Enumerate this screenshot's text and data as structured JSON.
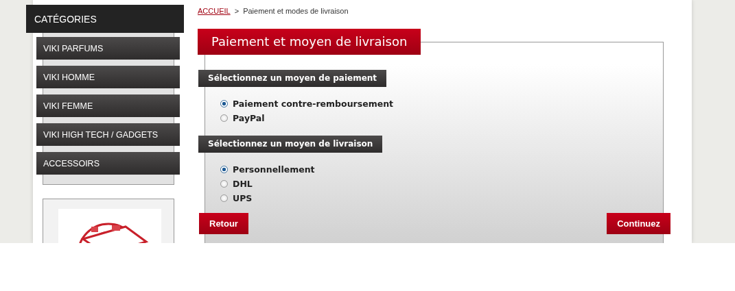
{
  "sidebar": {
    "title": "CATÉGORIES",
    "items": [
      {
        "label": "VIKI PARFUMS"
      },
      {
        "label": "VIKI HOMME"
      },
      {
        "label": "VIKI FEMME"
      },
      {
        "label": "VIKI HIGH TECH / GADGETS"
      },
      {
        "label": "ACCESSOIRS"
      }
    ]
  },
  "breadcrumb": [
    {
      "label": "ACCUEIL",
      "kind": "link"
    },
    {
      "label": ">",
      "kind": "separator"
    },
    {
      "label": "Paiement et modes de livraison",
      "kind": "current"
    }
  ],
  "panel": {
    "title": "Paiement et moyen de livraison",
    "sections": [
      {
        "title": "Sélectionnez un moyen de paiement",
        "options": [
          {
            "label": "Paiement contre-remboursement",
            "selected": true
          },
          {
            "label": "PayPal",
            "selected": false
          }
        ]
      },
      {
        "title": "Sélectionnez un moyen de livraison",
        "options": [
          {
            "label": "Personnellement",
            "selected": true
          },
          {
            "label": "DHL",
            "selected": false
          },
          {
            "label": "UPS",
            "selected": false
          }
        ]
      }
    ]
  },
  "buttons": [
    {
      "label": "Retour"
    },
    {
      "label": "Continuez"
    }
  ]
}
